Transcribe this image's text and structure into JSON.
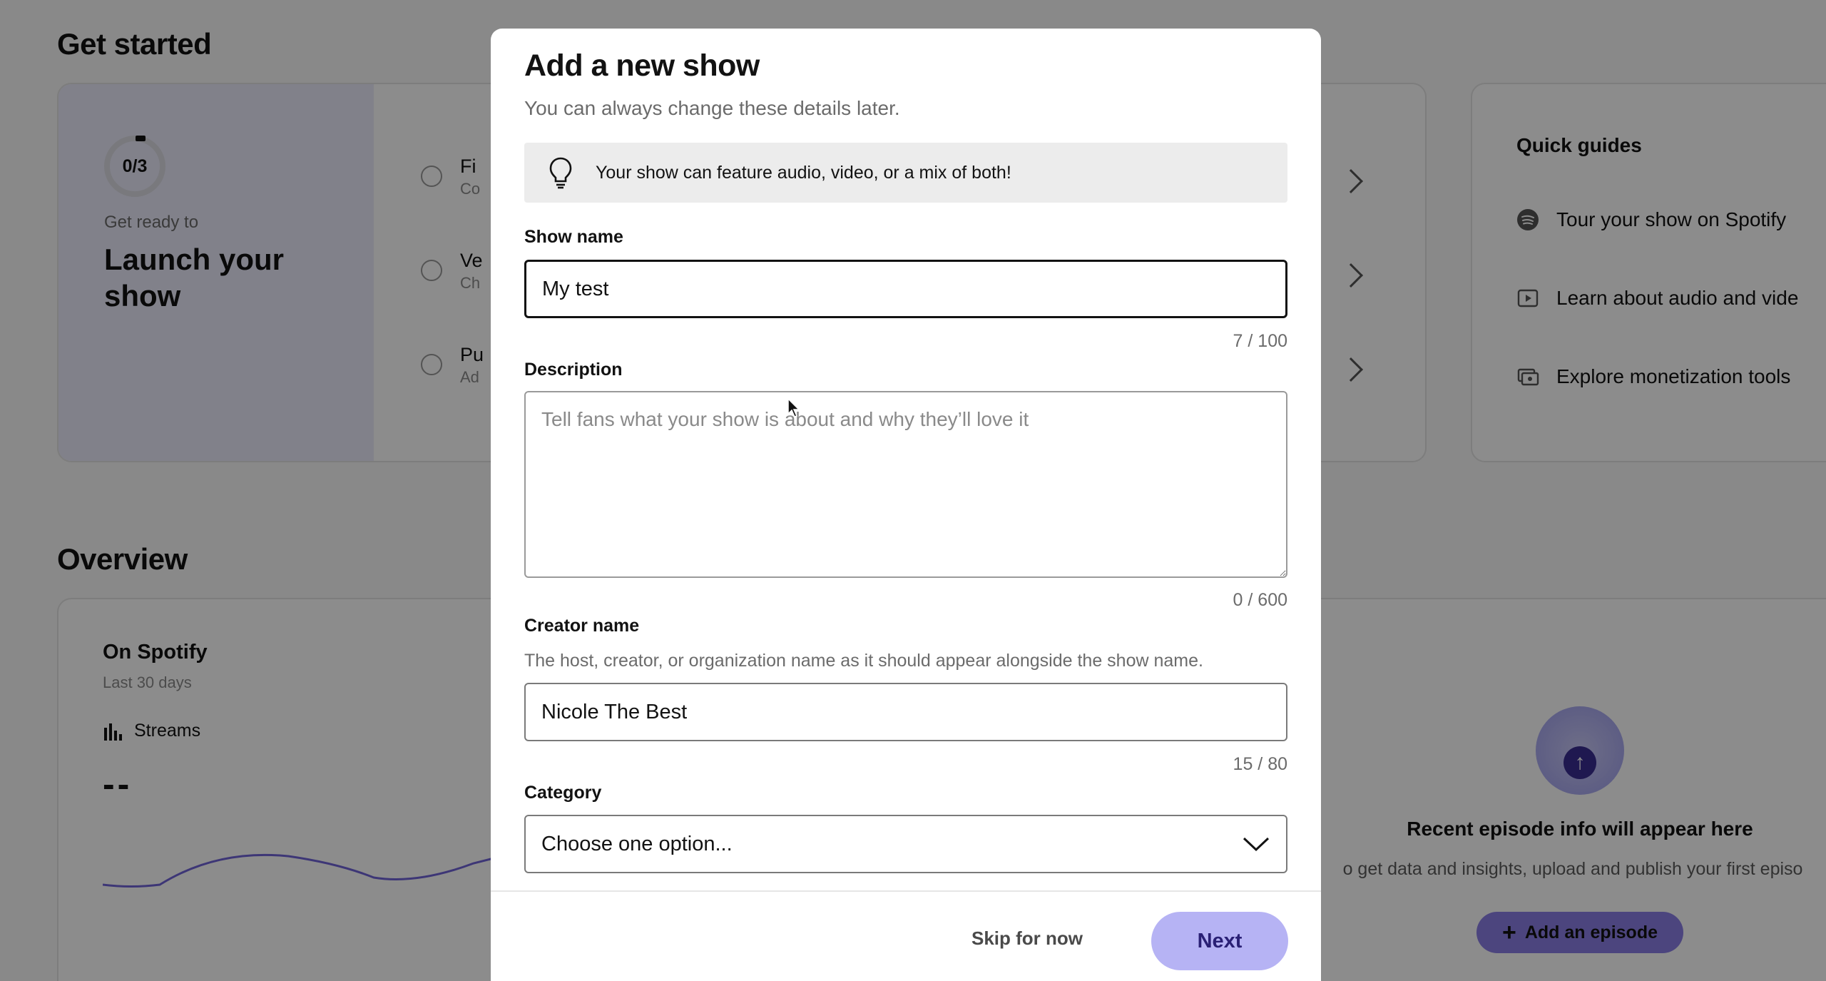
{
  "background": {
    "get_started": {
      "title": "Get started",
      "progress": "0/3",
      "get_ready": "Get ready to",
      "launch_title": "Launch your show",
      "tasks": [
        {
          "title": "Fi",
          "sub": "Co"
        },
        {
          "title": "Ve",
          "sub": "Ch"
        },
        {
          "title": "Pu",
          "sub": "Ad"
        }
      ]
    },
    "quick_guides": {
      "title": "Quick guides",
      "items": [
        {
          "label": "Tour your show on Spotify",
          "icon": "spotify-icon"
        },
        {
          "label": "Learn about audio and vide",
          "icon": "video-play-icon"
        },
        {
          "label": "Explore monetization tools",
          "icon": "monetization-icon"
        }
      ]
    },
    "overview": {
      "title": "Overview",
      "card_title": "On Spotify",
      "card_sub": "Last 30 days",
      "metric_label": "Streams",
      "metric_value": "--"
    },
    "recent_episode": {
      "title": "Recent episode info will appear here",
      "subtitle": "o get data and insights, upload and publish your first episo",
      "button": "Add an episode"
    }
  },
  "modal": {
    "title": "Add a new show",
    "subtitle": "You can always change these details later.",
    "tip": "Your show can feature audio, video, or a mix of both!",
    "show_name": {
      "label": "Show name",
      "value": "My test",
      "counter": "7 / 100"
    },
    "description": {
      "label": "Description",
      "placeholder": "Tell fans what your show is about and why they’ll love it",
      "counter": "0 / 600"
    },
    "creator_name": {
      "label": "Creator name",
      "help": "The host, creator, or organization name as it should appear alongside the show name.",
      "value": "Nicole The Best",
      "counter": "15 / 80"
    },
    "category": {
      "label": "Category",
      "value": "Choose one option..."
    },
    "skip_label": "Skip for now",
    "next_label": "Next"
  },
  "colors": {
    "accent": "#b6b3f4",
    "accent_text": "#2a2075",
    "launch_panel": "#ececfb",
    "overlay": "rgba(0,0,0,0.45)"
  }
}
